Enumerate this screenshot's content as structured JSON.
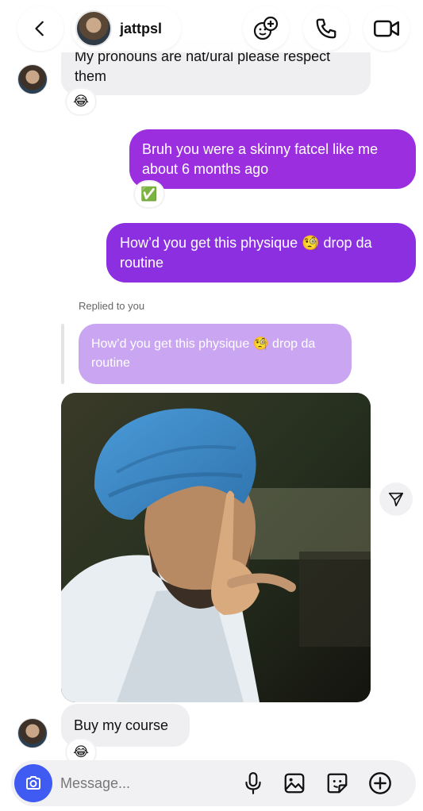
{
  "header": {
    "username": "jattpsl"
  },
  "messages": [
    {
      "id": "m1",
      "text": "My pronouns are nat/ural please respect them",
      "reaction": "😂"
    },
    {
      "id": "m2",
      "text": "Bruh you were a skinny fatcel like me about 6 months ago",
      "reaction": "✅"
    },
    {
      "id": "m3",
      "text": "How’d you get this physique 🧐 drop da routine"
    },
    {
      "id": "m4",
      "reply_label": "Replied to you",
      "quoted_text": "How’d you get this physique 🧐 drop da routine"
    },
    {
      "id": "m5",
      "text": "Buy my course",
      "reaction": "😂"
    }
  ],
  "composer": {
    "placeholder": "Message..."
  },
  "icons": {
    "back": "chevron-left-icon",
    "group": "add-people-icon",
    "call": "phone-icon",
    "video": "video-camera-icon",
    "share": "send-icon",
    "camera": "camera-icon",
    "mic": "microphone-icon",
    "gallery": "image-icon",
    "sticker": "sticker-icon",
    "more": "plus-icon"
  },
  "colors": {
    "outgoing_bubble": "#9b2fe0",
    "incoming_bubble": "#efeff1",
    "quoted_bubble": "#c9a5f2",
    "camera_button": "#3f5bf2"
  }
}
